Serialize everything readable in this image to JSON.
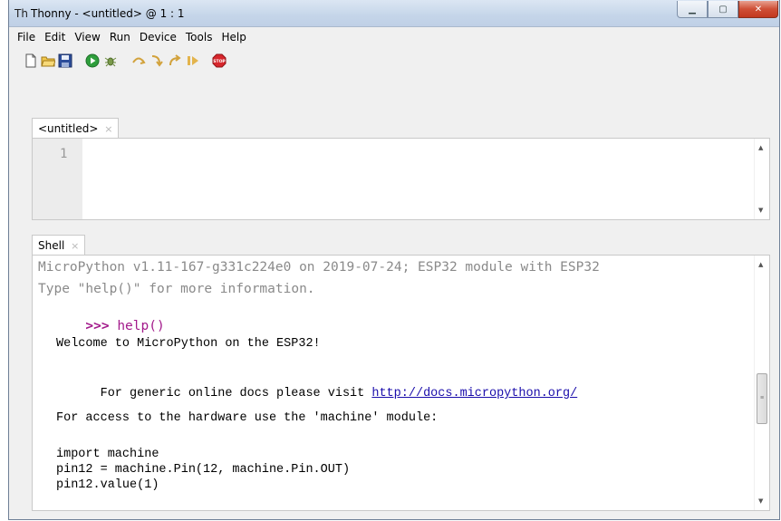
{
  "window": {
    "title": "Thonny  -  <untitled>  @  1 : 1",
    "app_icon": "Th",
    "controls": {
      "minimize": "▁",
      "maximize": "▢",
      "close": "✕"
    }
  },
  "menu": [
    "File",
    "Edit",
    "View",
    "Run",
    "Device",
    "Tools",
    "Help"
  ],
  "toolbar": {
    "icons": [
      "new-file-icon",
      "open-folder-icon",
      "save-icon",
      "run-icon",
      "debug-icon",
      "step-over-icon",
      "step-into-icon",
      "step-out-icon",
      "resume-icon",
      "stop-icon"
    ],
    "stop_label": "STOP"
  },
  "editor": {
    "tab_label": "<untitled>",
    "tab_close": "×",
    "line_numbers": [
      "1"
    ]
  },
  "shell": {
    "tab_label": "Shell",
    "tab_close": "×",
    "banner_line1": "MicroPython v1.11-167-g331c224e0 on 2019-07-24; ESP32 module with ESP32",
    "banner_line2": "Type \"help()\" for more information.",
    "prompt": ">>>",
    "command": " help()",
    "output": {
      "welcome": "Welcome to MicroPython on the ESP32!",
      "docs_text": "For generic online docs please visit ",
      "docs_url": "http://docs.micropython.org/",
      "hardware": "For access to the hardware use the 'machine' module:",
      "code1": "import machine",
      "code2": "pin12 = machine.Pin(12, machine.Pin.OUT)",
      "code3": "pin12.value(1)"
    }
  },
  "colors": {
    "prompt": "#a31a8b",
    "banner": "#8a8a8a",
    "link": "#1a0dab",
    "close_button": "#c2381f"
  }
}
